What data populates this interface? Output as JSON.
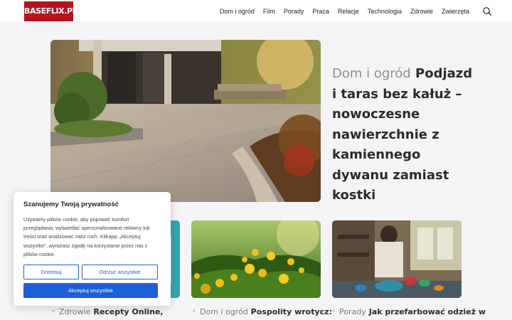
{
  "site": {
    "logo": "BASEFLIX.PL"
  },
  "nav": {
    "items": [
      "Dom i ogród",
      "Film",
      "Porady",
      "Praca",
      "Relacje",
      "Technologia",
      "Zdrowie",
      "Zwierzęta"
    ]
  },
  "hero": {
    "category": "Dom i ogród",
    "title": "Podjazd i taras bez kałuż – nowoczesne nawierzchnie z kamiennego dywanu zamiast kostki"
  },
  "cards": [
    {
      "category": "Zdrowie",
      "title": "Recepty Online,"
    },
    {
      "category": "Dom i ogród",
      "title": "Pospolity wrotycz:"
    },
    {
      "category": "Porady",
      "title": "Jak przefarbować odzież w"
    }
  ],
  "cookie": {
    "title": "Szanujemy Twoją prywatność",
    "text": "Używamy plików cookie, aby poprawić komfort przeglądania, wyświetlać spersonalizowane reklamy lub treści oraz analizować nasz ruch. Klikając „Akceptuj wszystko\", wyrażasz zgodę na korzystanie przez nas z plików cookie.",
    "customize_label": "Dostosuj",
    "reject_label": "Odrzuć wszystkie",
    "accept_label": "Akceptuj wszystkie"
  },
  "colors": {
    "brand": "#b3141d",
    "accent": "#1d5fd6"
  }
}
